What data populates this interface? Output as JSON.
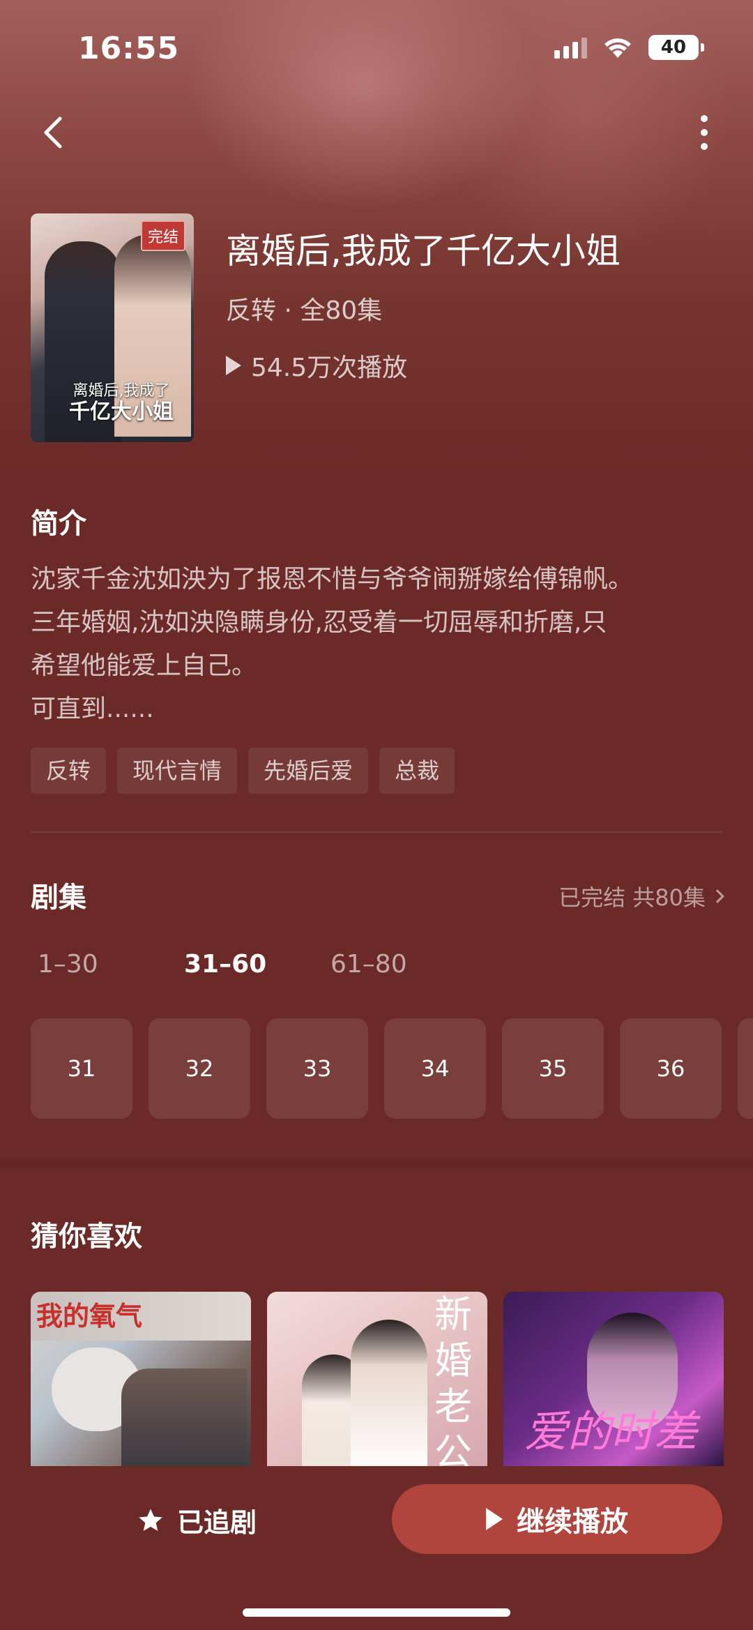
{
  "status_bar": {
    "time": "16:55",
    "battery": "40"
  },
  "drama": {
    "badge": "完结",
    "cover_title_line1": "离婚后,我成了",
    "cover_title_line2": "千亿大小姐",
    "title": "离婚后,我成了千亿大小姐",
    "meta": "反转 · 全80集",
    "plays": "54.5万次播放"
  },
  "intro": {
    "heading": "简介",
    "lines": [
      "沈家千金沈如泱为了报恩不惜与爷爷闹掰嫁给傅锦帆。",
      "三年婚姻,沈如泱隐瞒身份,忍受着一切屈辱和折磨,只",
      "希望他能爱上自己。",
      "可直到......"
    ],
    "tags": [
      "反转",
      "现代言情",
      "先婚后爱",
      "总裁"
    ]
  },
  "episodes": {
    "heading": "剧集",
    "summary": "已完结 共80集",
    "ranges": [
      "1–30",
      "31–60",
      "61–80"
    ],
    "active_range": 1,
    "items": [
      "31",
      "32",
      "33",
      "34",
      "35",
      "36"
    ]
  },
  "recommend": {
    "heading": "猜你喜欢",
    "items": [
      {
        "cover_text": "我的氧气"
      },
      {
        "cover_text": "新婚老公"
      },
      {
        "cover_text": "爱的时差"
      }
    ]
  },
  "bottom": {
    "follow_label": "已追剧",
    "play_label": "继续播放"
  },
  "colors": {
    "background": "#6b2a27",
    "accent": "#b1443d",
    "badge": "#c03a35"
  }
}
